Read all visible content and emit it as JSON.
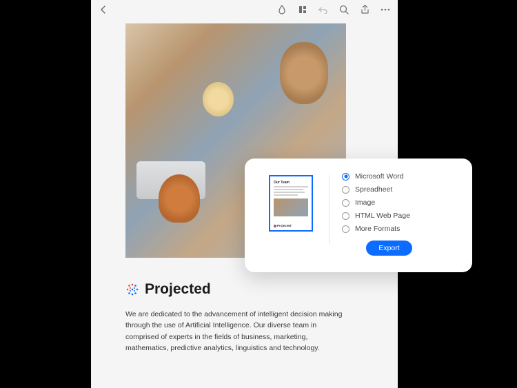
{
  "document": {
    "brand_name": "Projected",
    "body_text": "We are dedicated to the advancement of intelligent decision making through the use of Artificial Intelligence. Our diverse team in comprised of experts in the fields of business,  marketing, mathematics, predictive analytics, linguistics and technology."
  },
  "thumbnail": {
    "title": "Our Team",
    "brand": "Projected"
  },
  "export": {
    "options": [
      {
        "label": "Microsoft Word",
        "selected": true
      },
      {
        "label": "Spreadheet",
        "selected": false
      },
      {
        "label": "Image",
        "selected": false
      },
      {
        "label": "HTML Web Page",
        "selected": false
      },
      {
        "label": "More Formats",
        "selected": false
      }
    ],
    "button_label": "Export"
  }
}
